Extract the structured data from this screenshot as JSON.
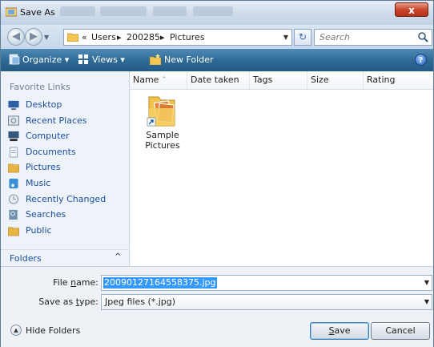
{
  "window": {
    "title": "Save As",
    "close_glyph": "x"
  },
  "address": {
    "back_glyph": "◀",
    "forward_glyph": "▶",
    "crumbs": [
      "«",
      "Users",
      "▸",
      "200285",
      "▸",
      "Pictures"
    ],
    "search_placeholder": "Search"
  },
  "toolbar": {
    "organize_label": "Organize",
    "views_label": "Views",
    "newfolder_label": "New Folder",
    "help_glyph": "?"
  },
  "nav": {
    "heading": "Favorite Links",
    "items": [
      {
        "label": "Desktop",
        "icon": "desktop-icon",
        "color": "#2d5fa6"
      },
      {
        "label": "Recent Places",
        "icon": "recent-places-icon",
        "color": "#6f7f8f"
      },
      {
        "label": "Computer",
        "icon": "computer-icon",
        "color": "#31577f"
      },
      {
        "label": "Documents",
        "icon": "documents-icon",
        "color": "#8aa0b6"
      },
      {
        "label": "Pictures",
        "icon": "pictures-folder-icon",
        "color": "#e8b443"
      },
      {
        "label": "Music",
        "icon": "music-icon",
        "color": "#3a8ed6"
      },
      {
        "label": "Recently Changed",
        "icon": "recently-changed-icon",
        "color": "#7d8fa3"
      },
      {
        "label": "Searches",
        "icon": "searches-icon",
        "color": "#6e8fb0"
      },
      {
        "label": "Public",
        "icon": "public-folder-icon",
        "color": "#e8b443"
      }
    ],
    "folders_label": "Folders",
    "folders_chevron": "^"
  },
  "filelist": {
    "columns": [
      "Name",
      "Date taken",
      "Tags",
      "Size",
      "Rating"
    ],
    "sort_arrow": "^",
    "items": [
      {
        "caption": "Sample Pictures",
        "icon": "sample-pictures-folder-icon"
      }
    ]
  },
  "form": {
    "filename_label_pre": "File ",
    "filename_label_u": "n",
    "filename_label_post": "ame:",
    "filename_value": "20090127164558375.jpg",
    "type_label_pre": "Save as ",
    "type_label_u": "t",
    "type_label_post": "ype:",
    "type_value": "Jpeg files (*.jpg)"
  },
  "footer": {
    "hide_folders_label": "Hide Folders",
    "hide_glyph": "▲",
    "save_label_u": "S",
    "save_label_post": "ave",
    "cancel_label": "Cancel"
  },
  "colors": {
    "toolbar": "#2f6b96",
    "link": "#1c4fa0",
    "selection": "#3399ff"
  }
}
